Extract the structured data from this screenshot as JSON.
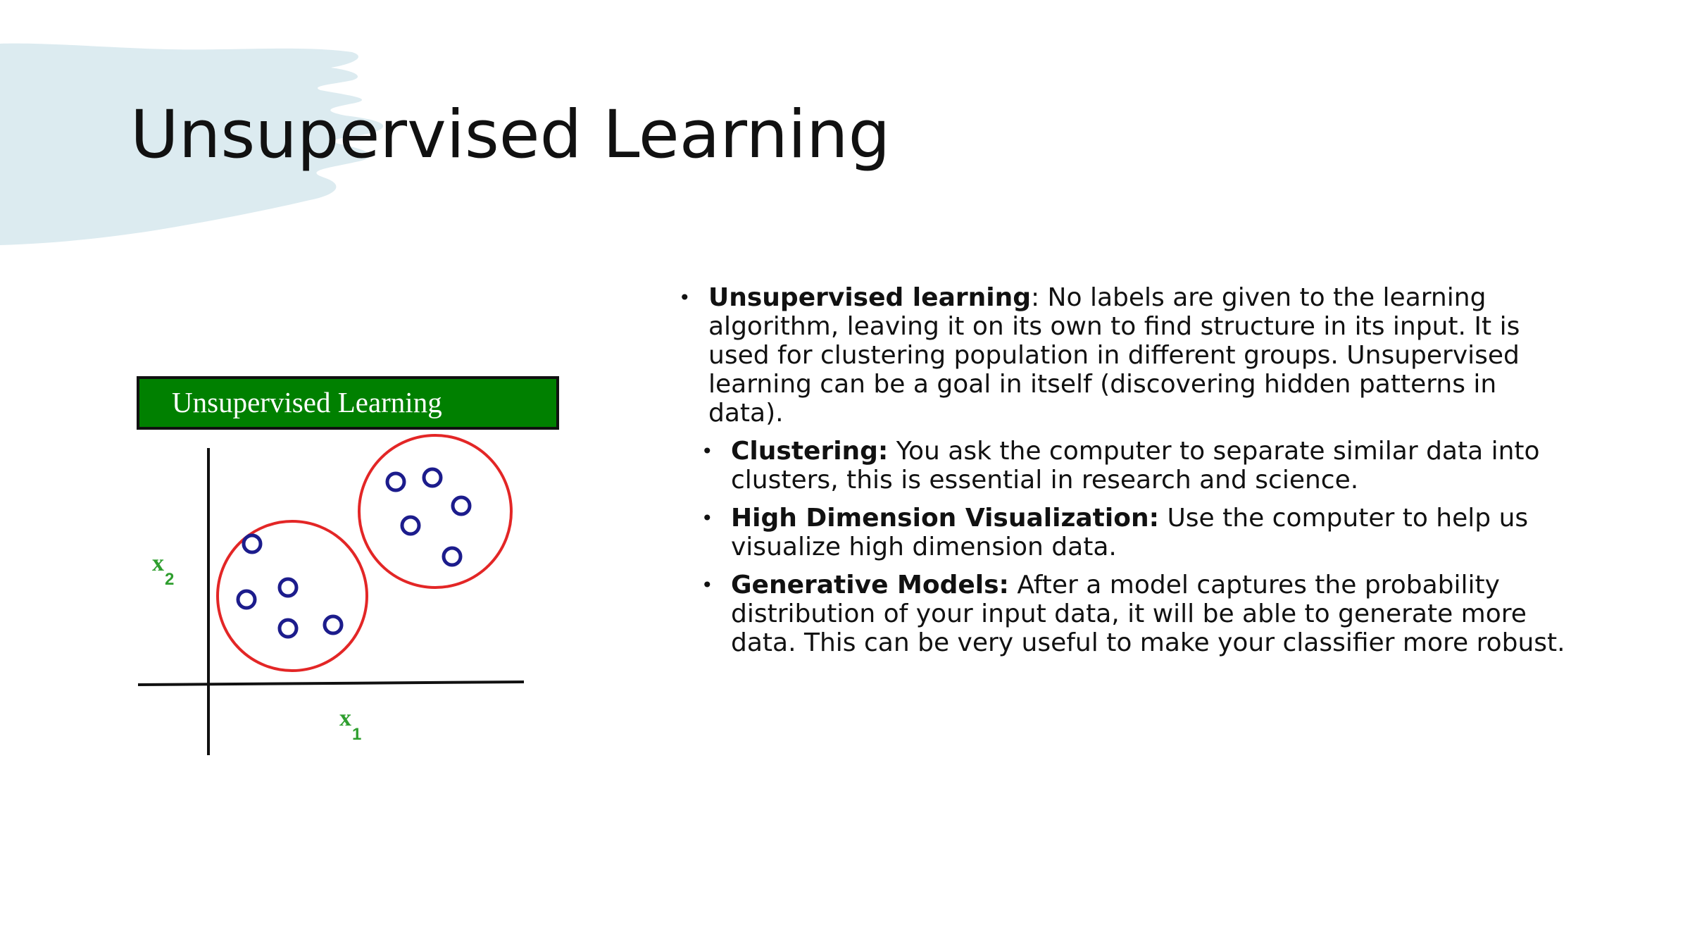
{
  "slide": {
    "title": "Unsupervised Learning",
    "accent_color": "#dcebf0"
  },
  "figure": {
    "header_label": "Unsupervised Learning",
    "header_color": "#008000",
    "x_axis_label": "x",
    "x_axis_subscript": "1",
    "y_axis_label": "x",
    "y_axis_subscript": "2",
    "axis_label_color": "#2e9e2e",
    "cluster_color": "#e32626",
    "point_color": "#1c1c8c"
  },
  "bullets": [
    {
      "level": 1,
      "term": "Unsupervised learning",
      "text": ": No labels are given to the learning algorithm, leaving it on its own to find structure in its input. It is used for clustering population in different groups. Unsupervised learning can be a goal in itself (discovering hidden patterns in data)."
    },
    {
      "level": 2,
      "term": "Clustering:",
      "text": " You ask the computer to separate similar data into clusters, this is essential in research and science."
    },
    {
      "level": 2,
      "term": "High Dimension Visualization:",
      "text": " Use the computer to help us visualize high dimension data."
    },
    {
      "level": 2,
      "term": "Generative Models:",
      "text": " After a model captures the probability distribution of your input data, it will be able to generate more data. This can be very useful to make your classifier more robust."
    }
  ]
}
